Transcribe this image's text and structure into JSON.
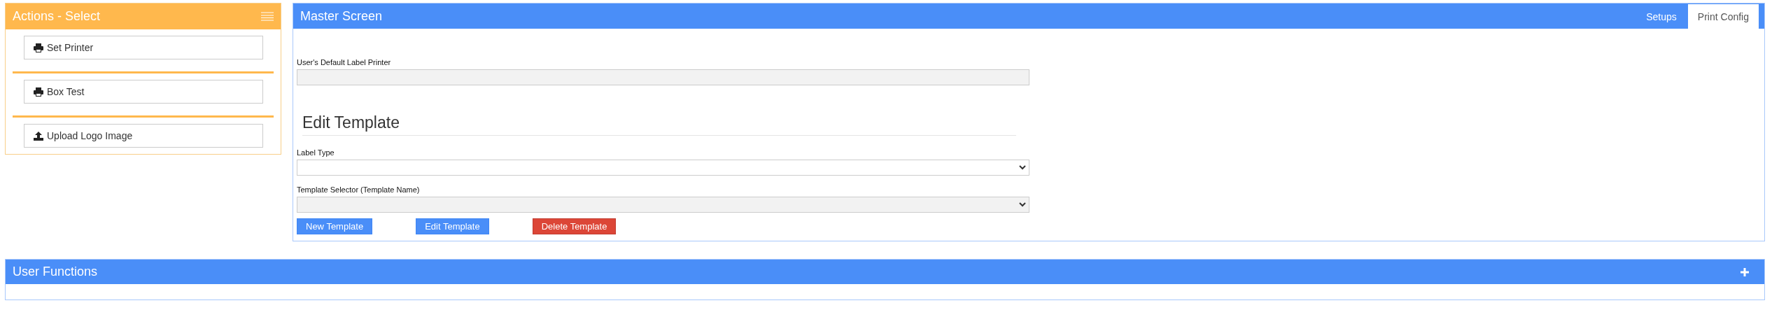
{
  "actions_panel": {
    "title": "Actions - Select",
    "buttons": [
      {
        "label": "Set Printer",
        "kind": "printer"
      },
      {
        "label": "Box Test",
        "kind": "printer"
      },
      {
        "label": "Upload Logo Image",
        "kind": "upload"
      }
    ]
  },
  "master_panel": {
    "title": "Master Screen",
    "tabs": [
      {
        "label": "Setups",
        "selected": false
      },
      {
        "label": "Print Config",
        "selected": true
      }
    ],
    "default_printer": {
      "label": "User's Default Label Printer",
      "disabled": true
    },
    "section_title": "Edit Template",
    "label_type": {
      "label": "Label Type",
      "disabled": false
    },
    "template_selector": {
      "label": "Template Selector (Template Name)",
      "disabled": true
    },
    "buttons": [
      {
        "label": "New Template",
        "kind": "primary"
      },
      {
        "label": "Edit Template",
        "kind": "primary"
      },
      {
        "label": "Delete Template",
        "kind": "danger"
      }
    ]
  },
  "user_functions": {
    "title": "User Functions",
    "expanded": false
  }
}
